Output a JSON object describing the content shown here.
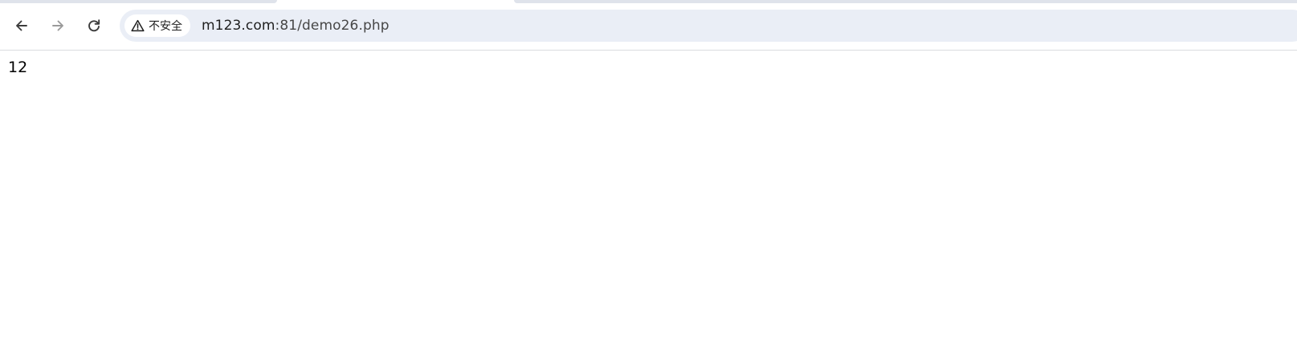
{
  "browser": {
    "nav": {
      "back_icon": "arrow-left-icon",
      "forward_icon": "arrow-right-icon",
      "reload_icon": "reload-icon"
    },
    "omnibox": {
      "security_icon": "warning-triangle-icon",
      "security_label": "不安全",
      "url_host": "m123.com",
      "url_path": ":81/demo26.php"
    },
    "colors": {
      "omnibox_bg": "#eaeef6",
      "tab_strip": "#dfe3eb",
      "text": "#1f1f1f"
    }
  },
  "page": {
    "output_text": "12"
  }
}
